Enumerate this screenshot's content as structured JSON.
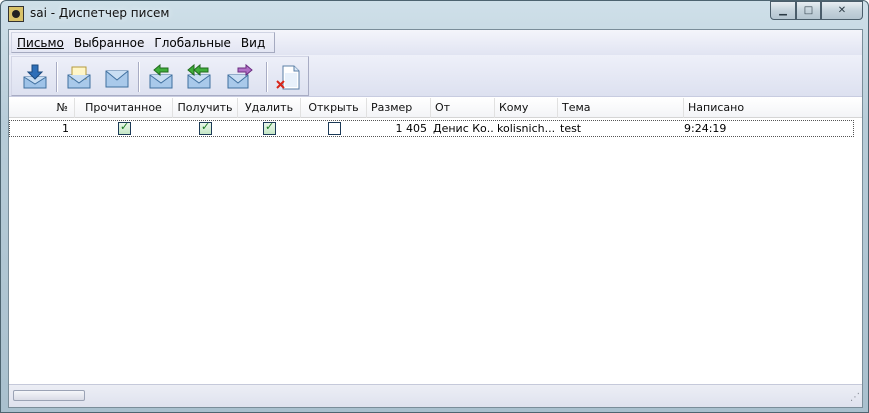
{
  "window": {
    "title": "sai - Диспетчер писем",
    "controls": {
      "minimize": "▁",
      "maximize": "□",
      "close": "✕"
    }
  },
  "menu": [
    {
      "label": "Письмо",
      "accel": "П"
    },
    {
      "label": "Выбранное",
      "accel": "В"
    },
    {
      "label": "Глобальные",
      "accel": "Г"
    },
    {
      "label": "Вид",
      "accel": "В"
    }
  ],
  "toolbar": {
    "icons": [
      "download-mail-icon",
      "open-envelope-icon",
      "closed-envelope-icon",
      "reply-icon",
      "reply-all-icon",
      "forward-icon",
      "delete-mail-icon"
    ]
  },
  "columns": [
    "№",
    "Прочитанное",
    "Получить",
    "Удалить",
    "Открыть",
    "Размер",
    "От",
    "Кому",
    "Тема",
    "Написано"
  ],
  "rows": [
    {
      "num": "1",
      "read": true,
      "receive": true,
      "delete": true,
      "open": false,
      "size": "1 405",
      "from": "Денис Ко...",
      "to": "kolisnich...",
      "subject": "test",
      "written": "9:24:19"
    }
  ],
  "colors": {
    "accent": "#1a7a22",
    "titlebar": "#b7ccd8"
  }
}
